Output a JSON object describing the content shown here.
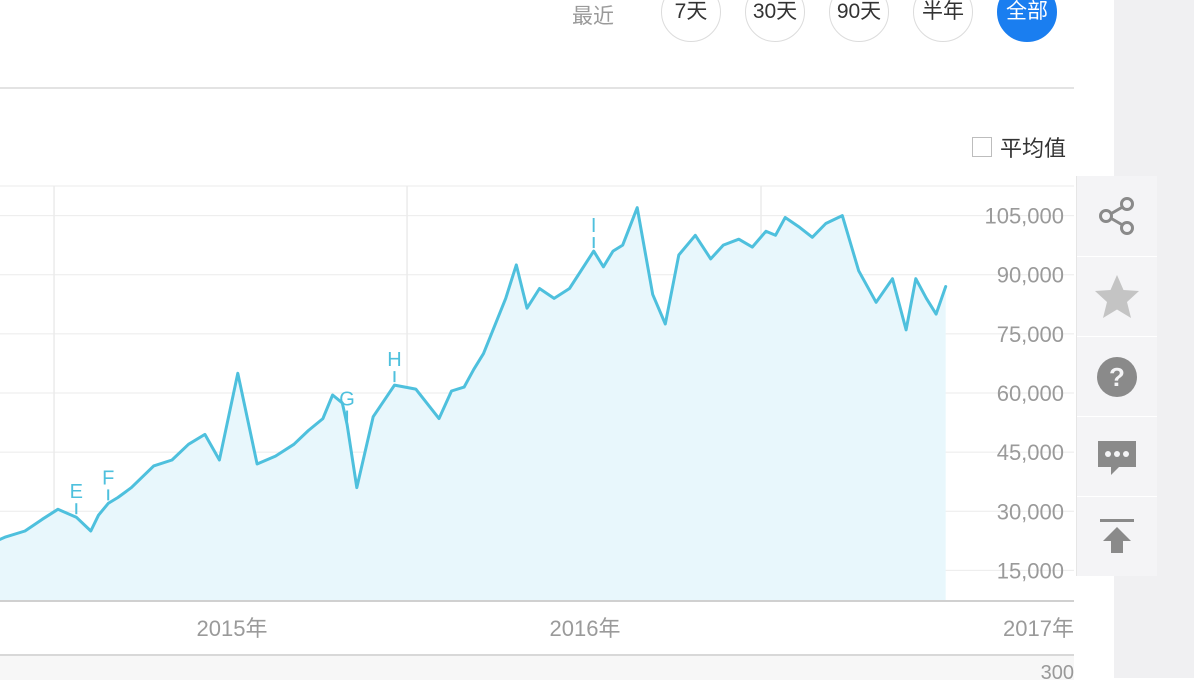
{
  "range": {
    "label": "最近",
    "buttons": [
      {
        "label": "7天",
        "active": false
      },
      {
        "label": "30天",
        "active": false
      },
      {
        "label": "90天",
        "active": false
      },
      {
        "label": "半年",
        "active": false
      },
      {
        "label": "全部",
        "active": true
      }
    ]
  },
  "avg_toggle": {
    "label": "平均值",
    "checked": false
  },
  "tools": [
    {
      "name": "share-icon"
    },
    {
      "name": "star-icon"
    },
    {
      "name": "help-icon"
    },
    {
      "name": "comment-icon"
    },
    {
      "name": "back-to-top-icon"
    }
  ],
  "bottom": {
    "value": "300"
  },
  "colors": {
    "line": "#4ec0dd",
    "fill": "#e8f7fc",
    "active": "#1a7ef0",
    "grid": "#ebebeb",
    "tick": "#9a9a9a",
    "icon": "#8a8a8a"
  },
  "chart_data": {
    "type": "area",
    "title": "",
    "xlabel": "",
    "ylabel": "",
    "x_ticks": [
      "2015年",
      "2016年",
      "2017年"
    ],
    "y_ticks": [
      15000,
      30000,
      45000,
      60000,
      75000,
      90000,
      105000
    ],
    "y_tick_labels": [
      "15,000",
      "30,000",
      "45,000",
      "60,000",
      "75,000",
      "90,000",
      "105,000"
    ],
    "ylim": [
      7500,
      112500
    ],
    "grid": true,
    "x": [
      "2014-04-28",
      "2014-05-12",
      "2014-06-01",
      "2014-06-19",
      "2014-07-05",
      "2014-07-24",
      "2014-08-08",
      "2014-08-16",
      "2014-08-26",
      "2014-09-05",
      "2014-09-19",
      "2014-10-12",
      "2014-10-31",
      "2014-11-17",
      "2014-12-04",
      "2014-12-19",
      "2015-01-07",
      "2015-01-27",
      "2015-02-15",
      "2015-03-06",
      "2015-03-21",
      "2015-04-05",
      "2015-04-15",
      "2015-04-25",
      "2015-04-30",
      "2015-05-10",
      "2015-05-27",
      "2015-06-18",
      "2015-07-10",
      "2015-08-03",
      "2015-08-16",
      "2015-08-29",
      "2015-09-08",
      "2015-09-18",
      "2015-10-11",
      "2015-10-22",
      "2015-11-02",
      "2015-11-15",
      "2015-11-30",
      "2015-12-16",
      "2016-01-10",
      "2016-01-20",
      "2016-01-30",
      "2016-02-09",
      "2016-02-24",
      "2016-03-11",
      "2016-03-24",
      "2016-04-07",
      "2016-04-24",
      "2016-05-10",
      "2016-05-23",
      "2016-06-08",
      "2016-06-22",
      "2016-07-06",
      "2016-07-16",
      "2016-07-26",
      "2016-08-10",
      "2016-08-23",
      "2016-09-06",
      "2016-09-23",
      "2016-10-10",
      "2016-10-28",
      "2016-11-14",
      "2016-11-28",
      "2016-12-08",
      "2016-12-19",
      "2016-12-29",
      "2017-01-08"
    ],
    "values": [
      22000,
      23500,
      25000,
      28000,
      30500,
      28500,
      25000,
      29000,
      32000,
      33500,
      36000,
      41500,
      43000,
      47000,
      49500,
      43000,
      65000,
      42000,
      44000,
      47000,
      50500,
      53500,
      59500,
      57500,
      52000,
      36000,
      54000,
      62000,
      61000,
      53500,
      60500,
      61500,
      66000,
      70000,
      84000,
      92500,
      81500,
      86500,
      84000,
      86500,
      96000,
      92000,
      96000,
      97500,
      107000,
      85000,
      77500,
      95000,
      100000,
      94000,
      97500,
      99000,
      97000,
      101000,
      100000,
      104500,
      102000,
      99500,
      103000,
      105000,
      91000,
      83000,
      89000,
      76000,
      89000,
      84000,
      80000,
      87000
    ],
    "annotations": [
      {
        "label": "E",
        "x": "2014-07-24",
        "y": 28500
      },
      {
        "label": "F",
        "x": "2014-08-26",
        "y": 32000
      },
      {
        "label": "G",
        "x": "2015-04-30",
        "y": 52000
      },
      {
        "label": "H",
        "x": "2015-06-18",
        "y": 62000
      },
      {
        "label": "I",
        "x": "2016-01-10",
        "y": 96000
      }
    ]
  }
}
